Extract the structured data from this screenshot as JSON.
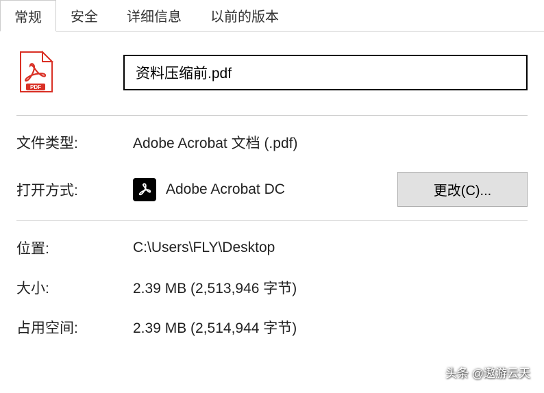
{
  "tabs": {
    "general": "常规",
    "security": "安全",
    "details": "详细信息",
    "previous": "以前的版本"
  },
  "filename": "资料压缩前.pdf",
  "properties": {
    "file_type_label": "文件类型:",
    "file_type_value": "Adobe Acrobat 文档 (.pdf)",
    "open_with_label": "打开方式:",
    "open_with_value": "Adobe Acrobat DC",
    "change_button": "更改(C)...",
    "location_label": "位置:",
    "location_value": "C:\\Users\\FLY\\Desktop",
    "size_label": "大小:",
    "size_value": "2.39 MB (2,513,946 字节)",
    "disk_size_label": "占用空间:",
    "disk_size_value": "2.39 MB (2,514,944 字节)"
  },
  "watermark": "头条 @遨游云天"
}
